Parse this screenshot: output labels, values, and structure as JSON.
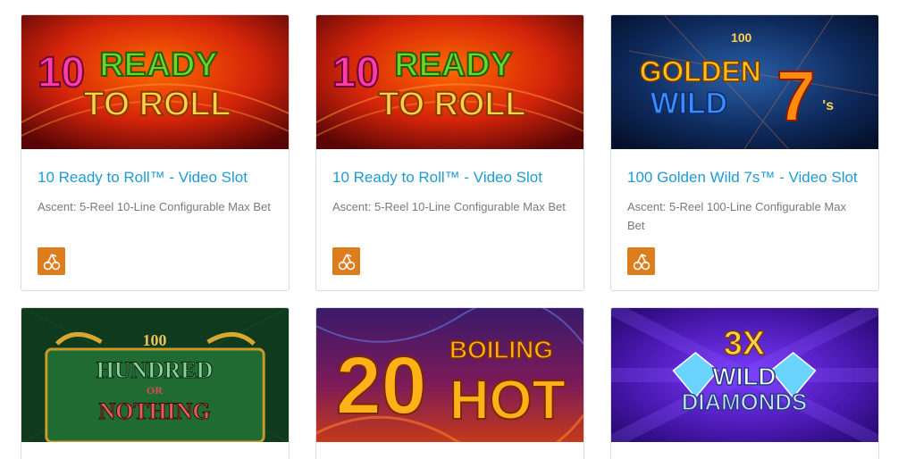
{
  "games": [
    {
      "title": "10 Ready to Roll™ - Video Slot",
      "description": "Ascent: 5-Reel 10-Line Configurable Max Bet",
      "art_number": "10",
      "art_line1": "READY",
      "art_line2": "TO ROLL",
      "feature_icon": "cherries-icon"
    },
    {
      "title": "10 Ready to Roll™ - Video Slot",
      "description": "Ascent: 5-Reel 10-Line Configurable Max Bet",
      "art_number": "10",
      "art_line1": "READY",
      "art_line2": "TO ROLL",
      "feature_icon": "cherries-icon"
    },
    {
      "title": "100 Golden Wild 7s™ - Video Slot",
      "description": "Ascent: 5-Reel 100-Line Configurable Max Bet",
      "art_top": "100",
      "art_line1": "GOLDEN",
      "art_line2": "WILD",
      "art_seven": "7",
      "art_suffix": "'s",
      "feature_icon": "cherries-icon"
    },
    {
      "art_top": "100",
      "art_line1": "HUNDRED",
      "art_mid": "OR",
      "art_line2": "NOTHING"
    },
    {
      "art_number": "20",
      "art_line1": "BOILING",
      "art_line2": "HOT"
    },
    {
      "art_line1": "3X",
      "art_line2": "WILD",
      "art_line3": "DIAMONDS"
    }
  ],
  "colors": {
    "title_link": "#1f9bd4",
    "description": "#7a7a7a",
    "feature_badge": "#dd7d1d",
    "card_border": "#dcdcdc"
  }
}
